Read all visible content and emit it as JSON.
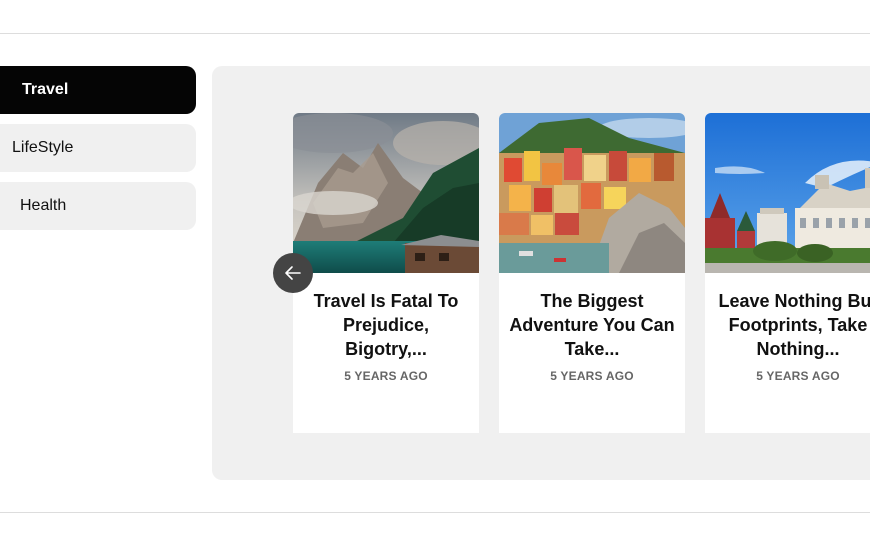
{
  "categories": [
    {
      "label": "Travel",
      "active": true
    },
    {
      "label": "LifeStyle",
      "active": false
    },
    {
      "label": "Health",
      "active": false
    }
  ],
  "carousel": {
    "prev_icon": "arrow-left-icon",
    "cards": [
      {
        "title": "Travel Is Fatal To Prejudice, Bigotry,...",
        "date": "5 YEARS AGO",
        "image": "mountain-lake-photo"
      },
      {
        "title": "The Biggest Adventure You Can Take...",
        "date": "5 YEARS AGO",
        "image": "coastal-village-photo"
      },
      {
        "title": "Leave Nothing But Footprints, Take Nothing...",
        "date": "5 YEARS AGO",
        "image": "city-square-photo"
      }
    ]
  },
  "colors": {
    "active_category_bg": "#050505",
    "inactive_category_bg": "#f0f0f0",
    "panel_bg": "#f0f0f0",
    "arrow_bg": "#444444"
  }
}
